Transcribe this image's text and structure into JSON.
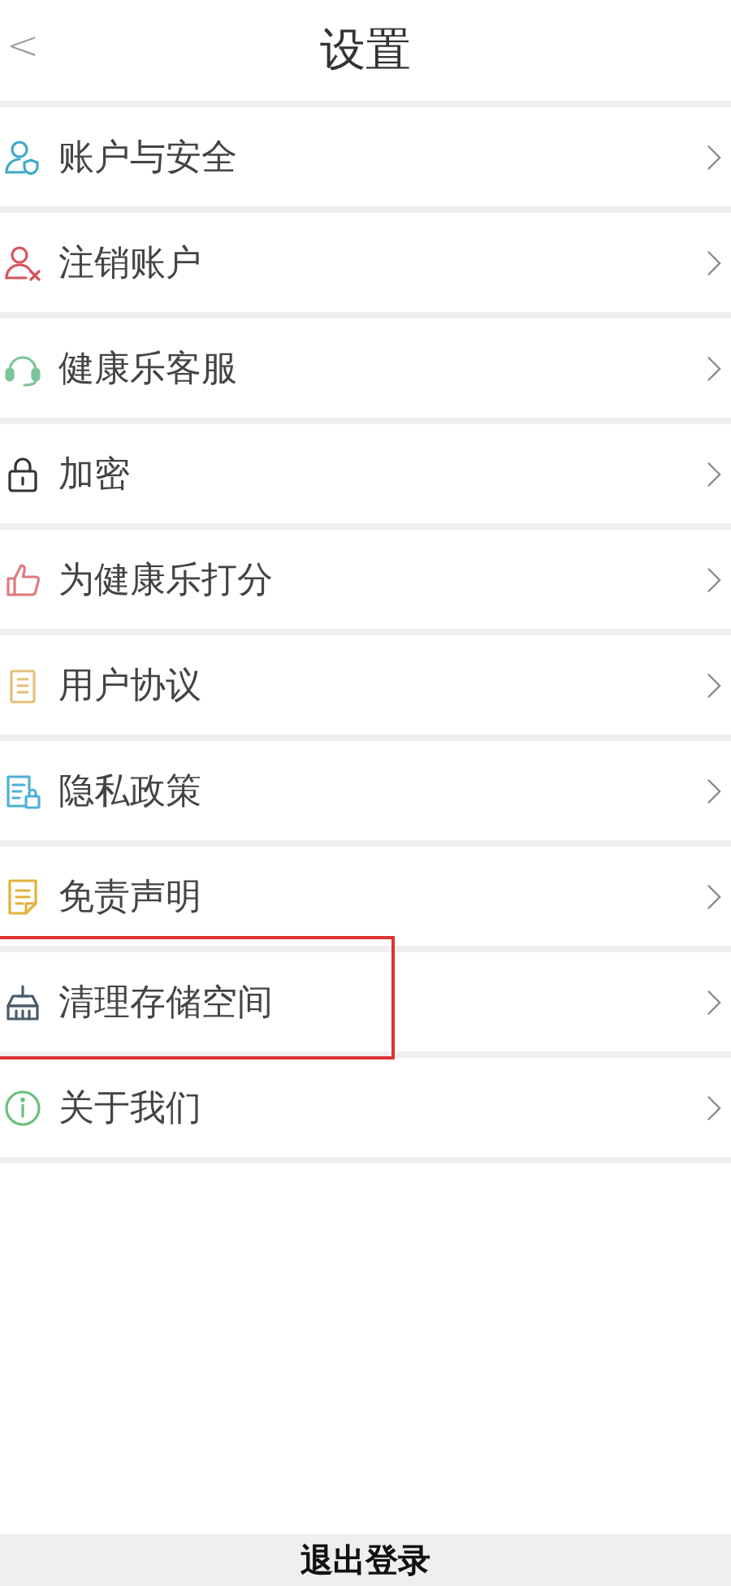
{
  "header": {
    "back": "<",
    "title": "设置"
  },
  "items": [
    {
      "color": "#3fa9c9",
      "label": "账户与安全",
      "highlighted": false
    },
    {
      "color": "#d9535b",
      "label": "注销账户",
      "highlighted": false
    },
    {
      "color": "#7cc49a",
      "label": "健康乐客服",
      "highlighted": false
    },
    {
      "color": "#333333",
      "label": "加密",
      "highlighted": false
    },
    {
      "color": "#e07a80",
      "label": "为健康乐打分",
      "highlighted": false
    },
    {
      "color": "#e3c07a",
      "label": "用户协议",
      "highlighted": false
    },
    {
      "color": "#4fb0d6",
      "label": "隐私政策",
      "highlighted": false
    },
    {
      "color": "#e3b23c",
      "label": "免责声明",
      "highlighted": false
    },
    {
      "color": "#4a5a6a",
      "label": "清理存储空间",
      "highlighted": true
    },
    {
      "color": "#6cbf7a",
      "label": "关于我们",
      "highlighted": false
    }
  ],
  "logout": "退出登录"
}
